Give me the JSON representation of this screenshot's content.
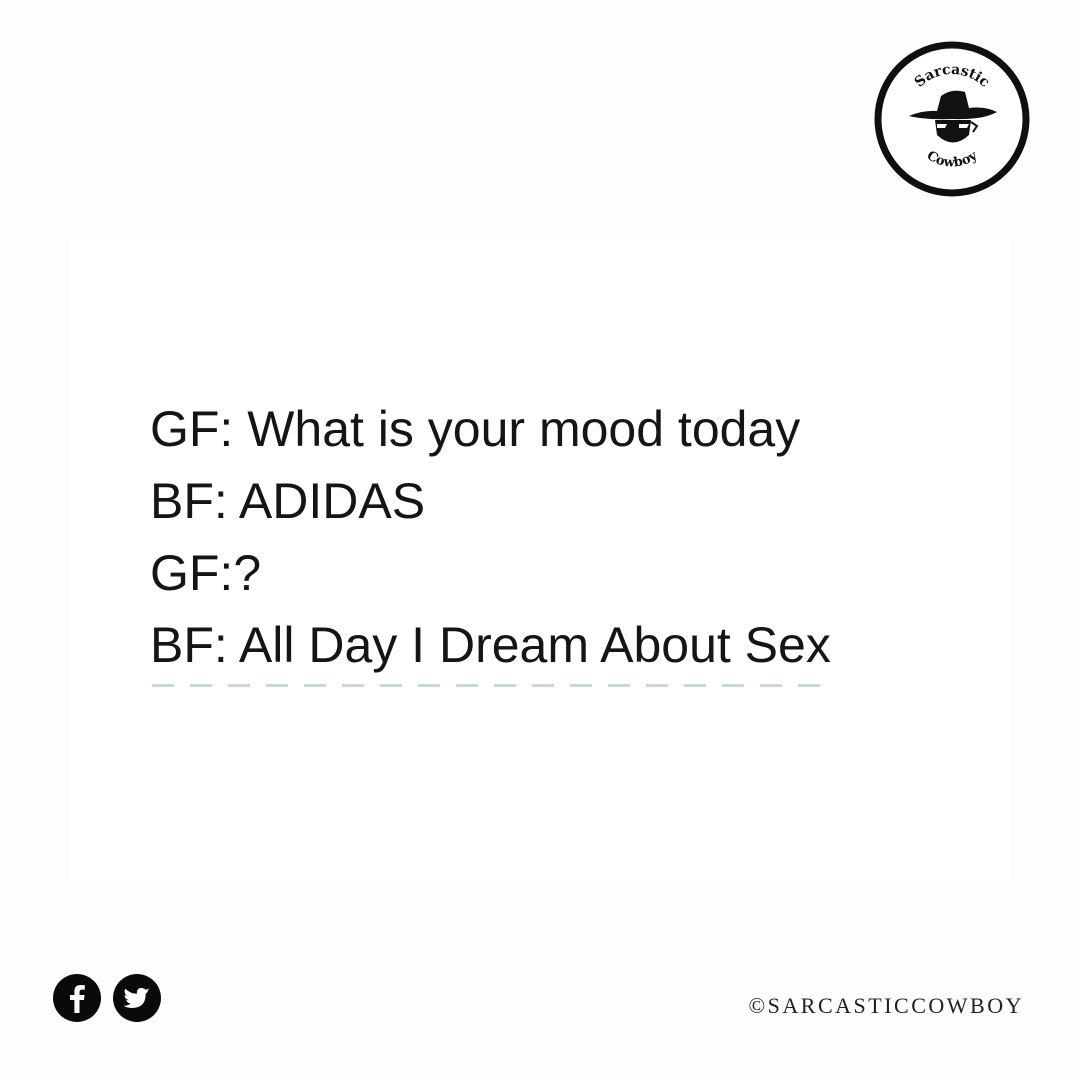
{
  "logo": {
    "top_text": "Sarcastic",
    "bottom_text": "Cowboy"
  },
  "post": {
    "lines": [
      "GF: What is your mood today",
      "BF: ADIDAS",
      "GF:?",
      "BF: All Day I Dream About Sex"
    ]
  },
  "footer": {
    "social_icons": [
      "facebook-icon",
      "twitter-icon"
    ],
    "copyright": "©SARCASTICCOWBOY"
  }
}
